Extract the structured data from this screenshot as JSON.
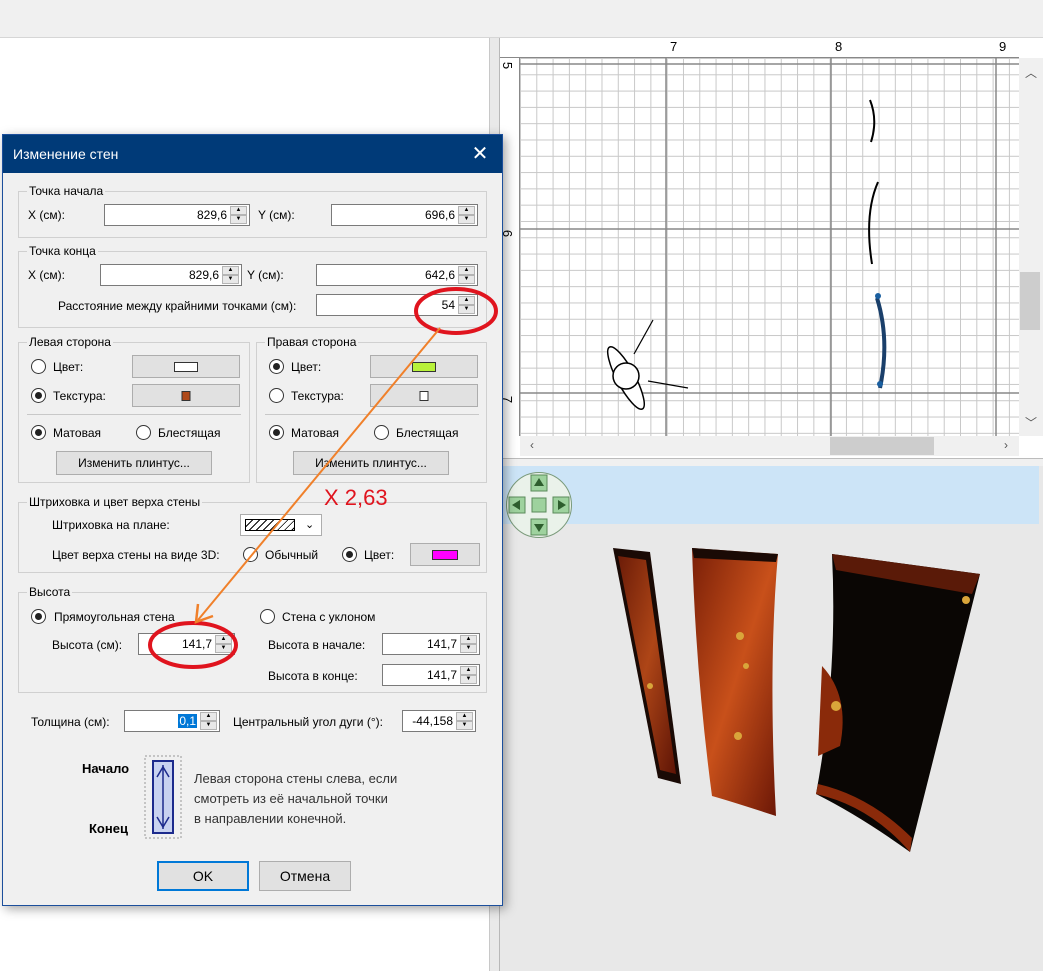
{
  "plan": {
    "ruler_x": [
      "7",
      "8",
      "9"
    ],
    "ruler_y": [
      "5",
      "6",
      "7"
    ]
  },
  "dialog": {
    "title": "Изменение стен",
    "start_point": {
      "title": "Точка начала",
      "x_label": "X (см):",
      "x_value": "829,6",
      "y_label": "Y (см):",
      "y_value": "696,6"
    },
    "end_point": {
      "title": "Точка конца",
      "x_label": "X (см):",
      "x_value": "829,6",
      "y_label": "Y (см):",
      "y_value": "642,6",
      "distance_label": "Расстояние между крайними точками (см):",
      "distance_value": "54"
    },
    "left_side": {
      "title": "Левая сторона",
      "color_label": "Цвет:",
      "texture_label": "Текстура:",
      "matte_label": "Матовая",
      "glossy_label": "Блестящая",
      "baseboard_button": "Изменить плинтус..."
    },
    "right_side": {
      "title": "Правая сторона",
      "color_label": "Цвет:",
      "texture_label": "Текстура:",
      "matte_label": "Матовая",
      "glossy_label": "Блестящая",
      "baseboard_button": "Изменить плинтус...",
      "color_swatch": "#b8f23a"
    },
    "hatch": {
      "title": "Штриховка и цвет верха стены",
      "plan_label": "Штриховка на плане:",
      "top_color_label": "Цвет верха стены на виде 3D:",
      "normal_label": "Обычный",
      "color_label": "Цвет:",
      "color_swatch": "#ff00ff"
    },
    "height": {
      "title": "Высота",
      "rect_label": "Прямоугольная стена",
      "height_label": "Высота (см):",
      "height_value": "141,7",
      "sloped_label": "Стена с уклоном",
      "start_height_label": "Высота в начале:",
      "start_height_value": "141,7",
      "end_height_label": "Высота в конце:",
      "end_height_value": "141,7"
    },
    "thickness_label": "Толщина (см):",
    "thickness_value": "0,1",
    "arc_label": "Центральный угол дуги (°):",
    "arc_value": "-44,158",
    "diagram_start": "Начало",
    "diagram_end": "Конец",
    "hint": [
      "Левая сторона стены слева, если",
      "смотреть из её начальной точки",
      "в направлении конечной."
    ],
    "ok_button": "OK",
    "cancel_button": "Отмена"
  },
  "annotation": {
    "text": "X 2,63",
    "circle_color": "#e0141e",
    "arrow_color": "#f0802a"
  }
}
